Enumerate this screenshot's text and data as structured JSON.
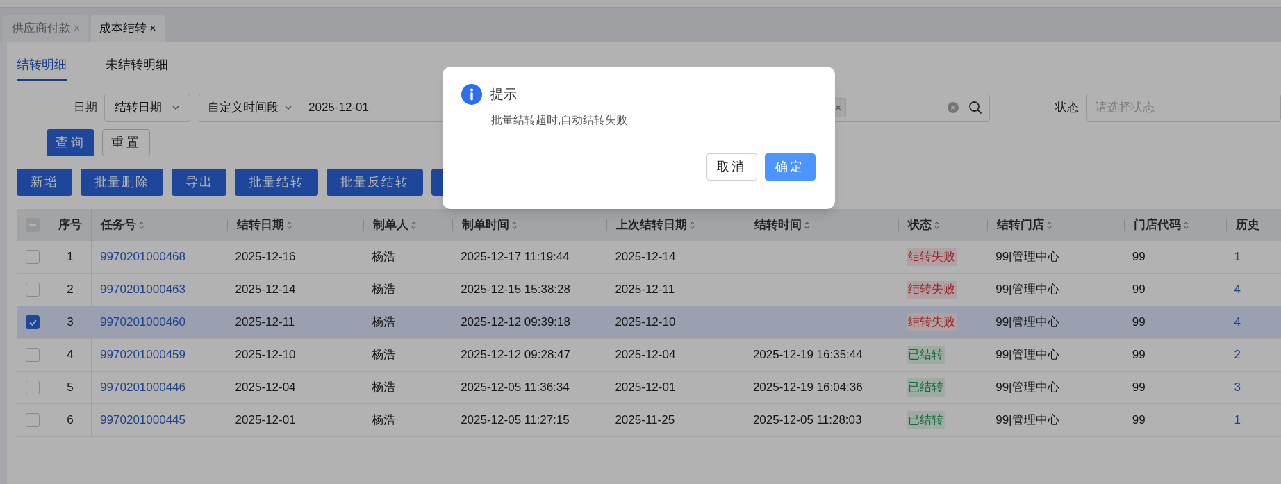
{
  "top_tabs": [
    {
      "label": "供应商付款",
      "close": "×",
      "selected": false
    },
    {
      "label": "成本结转",
      "close": "×",
      "selected": true
    }
  ],
  "sub_tabs": [
    {
      "label": "结转明细",
      "selected": true
    },
    {
      "label": "未结转明细",
      "selected": false
    }
  ],
  "filters": {
    "date_label": "日期",
    "date_type": "结转日期",
    "range_type": "自定义时间段",
    "start_date": "2025-12-01",
    "tag_close": "×",
    "status_label": "状态",
    "status_placeholder": "请选择状态"
  },
  "query_buttons": [
    {
      "label": "查询",
      "kind": "primary"
    },
    {
      "label": "重置",
      "kind": "default"
    }
  ],
  "toolbar": [
    "新增",
    "批量删除",
    "导出",
    "批量结转",
    "批量反结转"
  ],
  "table": {
    "header_checkbox": {
      "indeterminate": true
    },
    "columns": [
      {
        "label": "序号",
        "sortable": false
      },
      {
        "label": "任务号",
        "sortable": true
      },
      {
        "label": "结转日期",
        "sortable": true
      },
      {
        "label": "制单人",
        "sortable": true
      },
      {
        "label": "制单时间",
        "sortable": true
      },
      {
        "label": "上次结转日期",
        "sortable": true
      },
      {
        "label": "结转时间",
        "sortable": true
      },
      {
        "label": "状态",
        "sortable": true
      },
      {
        "label": "结转门店",
        "sortable": true
      },
      {
        "label": "门店代码",
        "sortable": true
      },
      {
        "label": "历史",
        "sortable": false
      }
    ],
    "rows": [
      {
        "selected": false,
        "index": "1",
        "task_no": "9970201000468",
        "date": "2025-12-16",
        "creator": "杨浩",
        "created_at": "2025-12-17 11:19:44",
        "last_date": "2025-12-14",
        "status": {
          "text": "结转失败",
          "kind": "failed"
        },
        "store": "99|管理中心",
        "store_code": "99",
        "history": "1"
      },
      {
        "selected": false,
        "index": "2",
        "task_no": "9970201000463",
        "date": "2025-12-14",
        "creator": "杨浩",
        "created_at": "2025-12-15 15:38:28",
        "last_date": "2025-12-11",
        "status": {
          "text": "结转失败",
          "kind": "failed"
        },
        "store": "99|管理中心",
        "store_code": "99",
        "history": "4"
      },
      {
        "selected": true,
        "index": "3",
        "task_no": "9970201000460",
        "date": "2025-12-11",
        "creator": "杨浩",
        "created_at": "2025-12-12 09:39:18",
        "last_date": "2025-12-10",
        "status": {
          "text": "结转失败",
          "kind": "failed"
        },
        "store": "99|管理中心",
        "store_code": "99",
        "history": "4"
      },
      {
        "selected": false,
        "index": "4",
        "task_no": "9970201000459",
        "date": "2025-12-10",
        "creator": "杨浩",
        "created_at": "2025-12-12 09:28:47",
        "last_date": "2025-12-04",
        "carry_time": "2025-12-19 16:35:44",
        "status": {
          "text": "已结转",
          "kind": "done"
        },
        "store": "99|管理中心",
        "store_code": "99",
        "history": "2"
      },
      {
        "selected": false,
        "index": "5",
        "task_no": "9970201000446",
        "date": "2025-12-04",
        "creator": "杨浩",
        "created_at": "2025-12-05 11:36:34",
        "last_date": "2025-12-01",
        "carry_time": "2025-12-19 16:04:36",
        "status": {
          "text": "已结转",
          "kind": "done"
        },
        "store": "99|管理中心",
        "store_code": "99",
        "history": "3"
      },
      {
        "selected": false,
        "index": "6",
        "task_no": "9970201000445",
        "date": "2025-12-01",
        "creator": "杨浩",
        "created_at": "2025-12-05 11:27:15",
        "last_date": "2025-11-25",
        "carry_time": "2025-12-05 11:28:03",
        "status": {
          "text": "已结转",
          "kind": "done"
        },
        "store": "99|管理中心",
        "store_code": "99",
        "history": "1"
      }
    ]
  },
  "dialog": {
    "title": "提示",
    "message": "批量结转超时,自动结转失败",
    "buttons": [
      {
        "label": "取消",
        "kind": "default"
      },
      {
        "label": "确定",
        "kind": "primary"
      }
    ]
  }
}
